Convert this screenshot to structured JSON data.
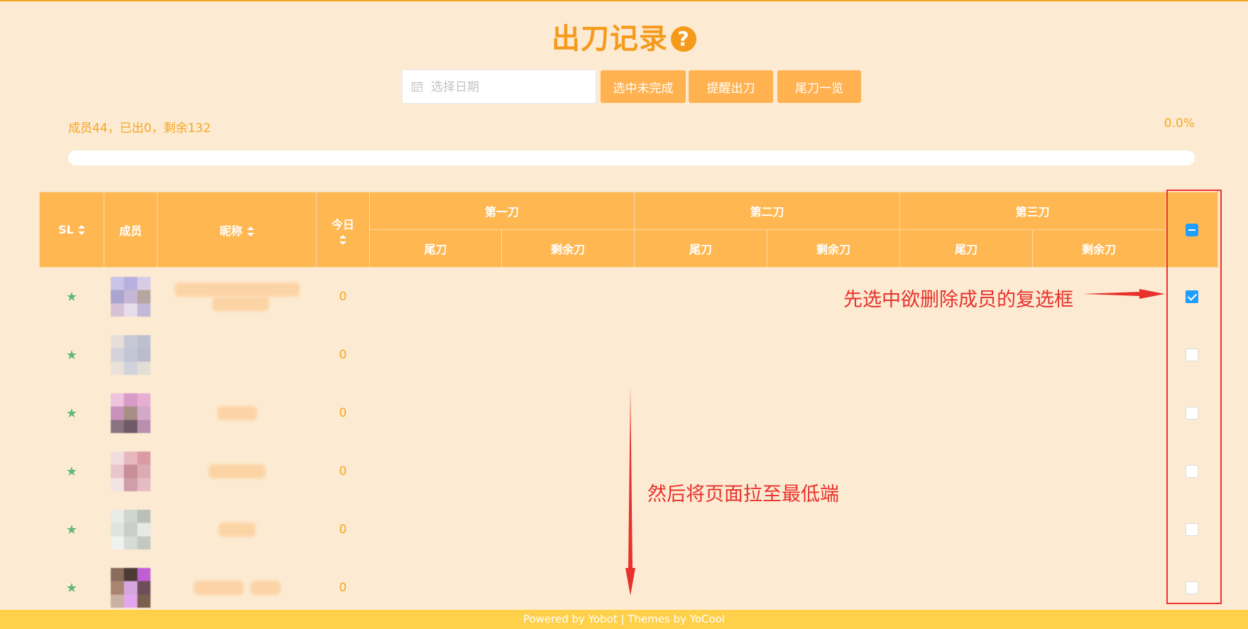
{
  "page": {
    "title": "出刀记录",
    "help_icon_glyph": "?"
  },
  "toolbar": {
    "date_placeholder": "选择日期",
    "buttons": [
      "选中未完成",
      "提醒出刀",
      "尾刀一览"
    ]
  },
  "summary": {
    "text": "成员44，已出0，剩余132",
    "percent_text": "0.0%",
    "progress_fraction": 0.0
  },
  "table": {
    "headers": {
      "sl": "SL",
      "member": "成员",
      "nickname": "昵称",
      "today": "今日",
      "rounds": [
        "第一刀",
        "第二刀",
        "第三刀"
      ],
      "sub": [
        "尾刀",
        "剩余刀"
      ]
    },
    "rows": [
      {
        "sl": "★",
        "today": "0",
        "checked": true
      },
      {
        "sl": "★",
        "today": "0",
        "checked": false
      },
      {
        "sl": "★",
        "today": "0",
        "checked": false
      },
      {
        "sl": "★",
        "today": "0",
        "checked": false
      },
      {
        "sl": "★",
        "today": "0",
        "checked": false
      },
      {
        "sl": "★",
        "today": "0",
        "checked": false
      }
    ]
  },
  "annotations": {
    "select_checkbox": "先选中欲删除成员的复选框",
    "scroll_down": "然后将页面拉至最低端"
  },
  "footer": {
    "text": "Powered by Yobot | Themes by YoCool"
  },
  "colors": {
    "background": "#fcebd2",
    "accent": "#f5a623",
    "header": "#ffb751",
    "checkbox": "#1e9fff",
    "annotation": "#e8312c",
    "footer": "#ffd04a"
  },
  "icons": [
    "question-icon",
    "calendar-icon",
    "sort-icon",
    "star-icon",
    "checkbox-icon"
  ]
}
